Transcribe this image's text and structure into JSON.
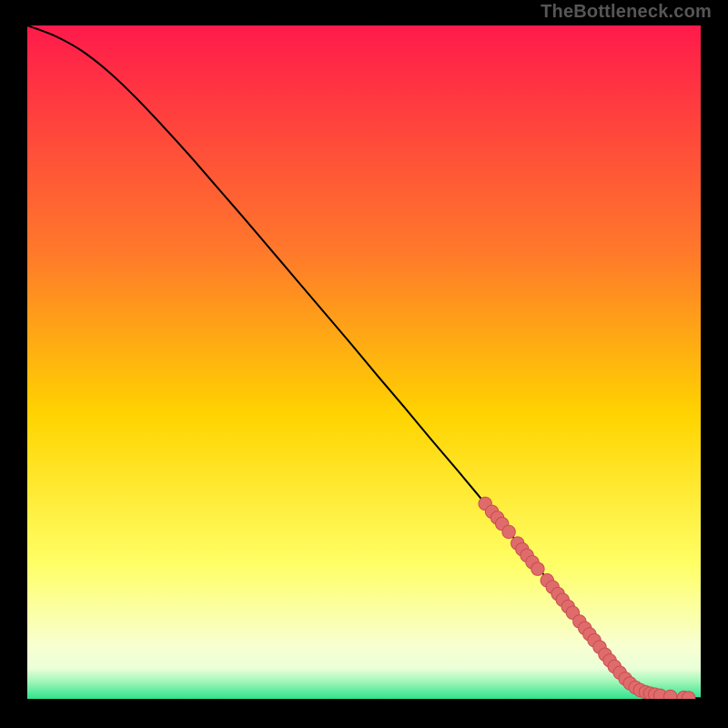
{
  "attribution": "TheBottleneck.com",
  "colors": {
    "background": "#000000",
    "gradient_top": "#ff1a4b",
    "gradient_mid_upper": "#ff6a2d",
    "gradient_mid": "#ffd400",
    "gradient_mid_lower": "#ffff66",
    "gradient_lower": "#f8ffd0",
    "gradient_green": "#2fe28e",
    "curve": "#000000",
    "point_fill": "#e06b6b",
    "point_stroke": "#c74d52"
  },
  "chart_data": {
    "type": "line",
    "title": "",
    "xlabel": "",
    "ylabel": "",
    "xlim": [
      0,
      100
    ],
    "ylim": [
      0,
      100
    ],
    "series": [
      {
        "name": "curve",
        "x": [
          0,
          4,
          8,
          12,
          16,
          20,
          24,
          28,
          32,
          36,
          40,
          44,
          48,
          52,
          56,
          60,
          64,
          68,
          72,
          76,
          80,
          82,
          84,
          86,
          88,
          90,
          92,
          94,
          96,
          98,
          100
        ],
        "y": [
          100,
          98.5,
          96.3,
          93.2,
          89.4,
          85.2,
          80.8,
          76.2,
          71.6,
          66.9,
          62.2,
          57.5,
          52.8,
          48.0,
          43.3,
          38.5,
          33.8,
          29.0,
          24.2,
          19.3,
          14.3,
          11.8,
          9.3,
          6.8,
          4.4,
          2.4,
          1.2,
          0.6,
          0.3,
          0.15,
          0.1
        ]
      }
    ],
    "scatter_points": {
      "name": "markers",
      "points": [
        {
          "x": 68.0,
          "y": 29.0
        },
        {
          "x": 69.0,
          "y": 27.8
        },
        {
          "x": 69.8,
          "y": 26.9
        },
        {
          "x": 70.5,
          "y": 26.0
        },
        {
          "x": 71.5,
          "y": 24.8
        },
        {
          "x": 72.8,
          "y": 23.1
        },
        {
          "x": 73.5,
          "y": 22.2
        },
        {
          "x": 74.2,
          "y": 21.3
        },
        {
          "x": 75.0,
          "y": 20.3
        },
        {
          "x": 75.8,
          "y": 19.3
        },
        {
          "x": 77.2,
          "y": 17.6
        },
        {
          "x": 78.0,
          "y": 16.6
        },
        {
          "x": 78.8,
          "y": 15.6
        },
        {
          "x": 79.5,
          "y": 14.7
        },
        {
          "x": 80.3,
          "y": 13.7
        },
        {
          "x": 81.0,
          "y": 12.8
        },
        {
          "x": 82.0,
          "y": 11.5
        },
        {
          "x": 82.8,
          "y": 10.5
        },
        {
          "x": 83.5,
          "y": 9.6
        },
        {
          "x": 84.2,
          "y": 8.7
        },
        {
          "x": 85.0,
          "y": 7.7
        },
        {
          "x": 85.8,
          "y": 6.6
        },
        {
          "x": 86.5,
          "y": 5.7
        },
        {
          "x": 87.2,
          "y": 4.8
        },
        {
          "x": 88.0,
          "y": 3.9
        },
        {
          "x": 88.8,
          "y": 3.0
        },
        {
          "x": 89.5,
          "y": 2.3
        },
        {
          "x": 90.3,
          "y": 1.7
        },
        {
          "x": 91.0,
          "y": 1.3
        },
        {
          "x": 91.8,
          "y": 1.0
        },
        {
          "x": 92.5,
          "y": 0.8
        },
        {
          "x": 93.2,
          "y": 0.65
        },
        {
          "x": 94.0,
          "y": 0.5
        },
        {
          "x": 95.5,
          "y": 0.35
        },
        {
          "x": 97.5,
          "y": 0.2
        },
        {
          "x": 98.2,
          "y": 0.15
        }
      ]
    }
  }
}
